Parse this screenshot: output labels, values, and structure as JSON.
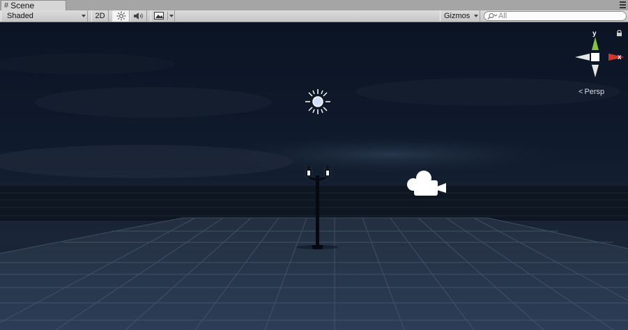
{
  "tab": {
    "title": "Scene"
  },
  "toolbar": {
    "shading_mode": "Shaded",
    "toggle_2d": "2D",
    "gizmos_label": "Gizmos",
    "search_placeholder": "All"
  },
  "viewport": {
    "projection_label": "Persp",
    "axis_y": "y",
    "axis_x": "x"
  },
  "colors": {
    "axis_y": "#84c441",
    "axis_x": "#d2382a",
    "sky": "#0d1626",
    "ground": "#2a3b55"
  },
  "icons": [
    "scene-tab-icon",
    "tab-menu-icon",
    "light-icon",
    "audio-icon",
    "image-effects-icon",
    "search-icon",
    "lock-icon",
    "directional-light-icon",
    "camera-icon",
    "orientation-gizmo-icon",
    "street-lamp-icon"
  ]
}
